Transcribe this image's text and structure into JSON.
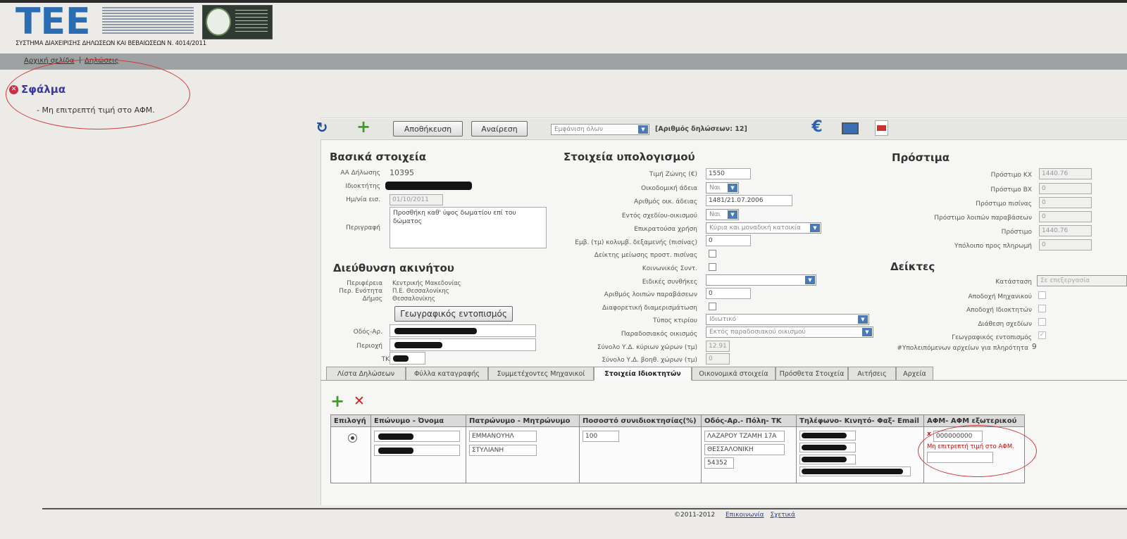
{
  "header": {
    "logo_text": "ΤΕΕ",
    "system_name": "ΣΥΣΤΗΜΑ ΔΙΑΧΕΙΡΙΣΗΣ ΔΗΛΩΣΕΩΝ ΚΑΙ ΒΕΒΑΙΩΣΕΩΝ Ν. 4014/2011",
    "nav": [
      "Αρχική σελίδα",
      "Δηλώσεις"
    ]
  },
  "error": {
    "title": "Σφάλμα",
    "message": "- Μη επιτρεπτή τιμή στο ΑΦΜ."
  },
  "toolbar": {
    "refresh_icon": "refresh-icon",
    "add_icon": "plus-icon",
    "save_label": "Αποθήκευση",
    "cancel_label": "Αναίρεση",
    "filter_value": "Εμφάνιση όλων",
    "count_text": "[Αριθμός δηλώσεων: 12]",
    "euro_icon": "€",
    "monitor_icon": "monitor-icon",
    "pdf_icon": "pdf-icon"
  },
  "basic": {
    "title": "Βασικά στοιχεία",
    "aa_label": "ΑΑ Δήλωσης",
    "aa_value": "10395",
    "owner_label": "Ιδιοκτήτης",
    "date_label": "Ημ/νία εισ.",
    "date_value": "01/10/2011",
    "desc_label": "Περιγραφή",
    "desc_value": "Προσθήκη καθ' ύψος δωματίου επί του δώματος"
  },
  "address": {
    "title": "Διεύθυνση ακινήτου",
    "region_label": "Περιφέρεια",
    "region_value": "Κεντρικής Μακεδονίας",
    "unit_label": "Περ. Ενότητα",
    "unit_value": "Π.Ε. Θεσσαλονίκης",
    "municipality_label": "Δήμος",
    "municipality_value": "Θεσσαλονίκης",
    "geo_button": "Γεωγραφικός εντοπισμός",
    "street_label": "Οδός-Αρ.",
    "area_label": "Περιοχή",
    "zip_label": "ΤΚ"
  },
  "calc": {
    "title": "Στοιχεία υπολογισμού",
    "zone_label": "Τιμή Ζώνης (€)",
    "zone_value": "1550",
    "permit_label": "Οικοδομική άδεια",
    "permit_value": "Ναι",
    "permit_no_label": "Αριθμός οικ. άδειας",
    "permit_no_value": "1481/21.07.2006",
    "inside_plan_label": "Εντός σχεδίου-οικισμού",
    "inside_plan_value": "Ναι",
    "use_label": "Επικρατούσα χρήση",
    "use_value": "Κύρια και μοναδική κατοικία",
    "pool_label": "Εμβ. (τμ) κολυμβ. δεξαμενής (πισίνας)",
    "pool_value": "0",
    "pool_index_label": "Δείκτης μείωσης προστ. πισίνας",
    "social_label": "Κοινωνικός Συντ.",
    "special_label": "Ειδικές συνθήκες",
    "other_label": "Αριθμός λοιπών παραβάσεων",
    "other_value": "0",
    "diff_label": "Διαφορετική διαμερισμάτωση",
    "type_label": "Τύπος κτιρίου",
    "type_value": "Ιδιωτικό",
    "trad_label": "Παραδοσιακός οικισμός",
    "trad_value": "Εκτός παραδοσιακού οικισμού",
    "main_sum_label": "Σύνολο Υ.Δ. κύριων χώρων (τμ)",
    "main_sum_value": "12.91",
    "aux_sum_label": "Σύνολο Υ.Δ. βοηθ. χώρων (τμ)",
    "aux_sum_value": "0"
  },
  "fines": {
    "title": "Πρόστιμα",
    "rows": [
      {
        "label": "Πρόστιμο ΚΧ",
        "value": "1440.76"
      },
      {
        "label": "Πρόστιμο ΒΧ",
        "value": "0"
      },
      {
        "label": "Πρόστιμο πισίνας",
        "value": "0"
      },
      {
        "label": "Πρόστιμο λοιπών παραβάσεων",
        "value": "0"
      },
      {
        "label": "Πρόστιμο",
        "value": "1440.76"
      },
      {
        "label": "Υπόλοιπο προς πληρωμή",
        "value": "0"
      }
    ]
  },
  "indicators": {
    "title": "Δείκτες",
    "status_label": "Κατάσταση",
    "status_value": "Σε επεξεργασία",
    "engineer_label": "Αποδοχή Μηχανικού",
    "owner_label": "Αποδοχή Ιδιοκτητών",
    "plans_label": "Διάθεση σχεδίων",
    "geo_label": "Γεωγραφικός εντοπισμός",
    "remaining_label": "#Υπολειπόμενων αρχείων για πληρότητα",
    "remaining_value": "9"
  },
  "tabs": [
    "Λίστα Δηλώσεων",
    "Φύλλα καταγραφής",
    "Συμμετέχοντες Μηχανικοί",
    "Στοιχεία Ιδιοκτητών",
    "Οικονομικά στοιχεία",
    "Πρόσθετα Στοιχεία",
    "Αιτήσεις",
    "Αρχεία"
  ],
  "owners": {
    "columns": [
      "Επιλογή",
      "Επώνυμο - Όνομα",
      "Πατρώνυμο - Μητρώνυμο",
      "Ποσοστό συνιδιοκτησίας(%)",
      "Οδός-Αρ.- Πόλη- ΤΚ",
      "Τηλέφωνο- Κινητό- Φαξ- Email",
      "ΑΦΜ- ΑΦΜ εξωτερικού"
    ],
    "father": "ΕΜΜΑΝΟΥΗΛ",
    "mother": "ΣΤΥΛΙΑΝΗ",
    "percent": "100",
    "street": "ΛΑΖΑΡΟΥ ΤΖΑΜΗ 17Α",
    "city": "ΘΕΣΣΑΛΟΝΙΚΗ",
    "zip": "54352",
    "afm": "000000000",
    "afm_error_mark": "x",
    "afm_error": "Μη επιτρεπτή τιμή στο ΑΦΜ."
  },
  "footer": {
    "copyright": "©2011-2012",
    "links": [
      "Επικοινωνία",
      "Σχετικά"
    ]
  },
  "colors": {
    "error_red": "#d23a3a",
    "heading_blue": "#3a3aa0",
    "select_blue": "#4b79b6",
    "plus_green": "#3aa020"
  }
}
